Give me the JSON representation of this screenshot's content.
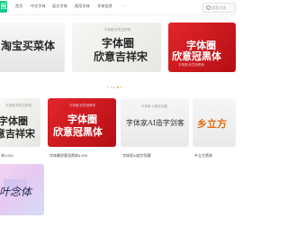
{
  "header": {
    "logo_text": "圈",
    "nav": [
      "首页",
      "中文字体",
      "英文字体",
      "图形字体",
      "字体信息",
      "···"
    ],
    "search_placeholder": "搜索字体"
  },
  "cards": [
    {
      "id": "c1",
      "texts": [
        "淘宝买菜体"
      ],
      "small": "",
      "label": ""
    },
    {
      "id": "c2",
      "texts": [
        "字体圈",
        "欣意吉祥宋"
      ],
      "small": "字体圈·欣意吉祥宋",
      "label": ""
    },
    {
      "id": "c3",
      "texts": [
        "字体圈",
        "欣意冠黑体"
      ],
      "small": "字体圈·欣意冠黑体",
      "label": ""
    },
    {
      "id": "c4",
      "texts": [
        "字体圈",
        "意吉祥宋"
      ],
      "small": "字体圈·欣意吉祥宋",
      "label": "宋1.001"
    },
    {
      "id": "c5",
      "texts": [
        "字体圈",
        "欣意冠黑体"
      ],
      "small": "字体圈·欣意冠黑体",
      "label": "字体圈欣意冠黑体4.009"
    },
    {
      "id": "c6",
      "texts": [
        "字体家AI造字剑客"
      ],
      "small": "字体家·AI造字剑客",
      "label": "字体家AI造字剑客"
    },
    {
      "id": "c7",
      "texts": [
        "乡立方"
      ],
      "small": "",
      "label": "乡立方黑体"
    },
    {
      "id": "c8",
      "texts": [
        "叶念体"
      ],
      "small": "",
      "label": ""
    }
  ],
  "carousel": {
    "active_index": 3,
    "count": 5
  },
  "colors": {
    "brand": "#16c784",
    "red_card": "#d81e24",
    "dot": "#f0a030",
    "orange_text": "#e26a12"
  }
}
